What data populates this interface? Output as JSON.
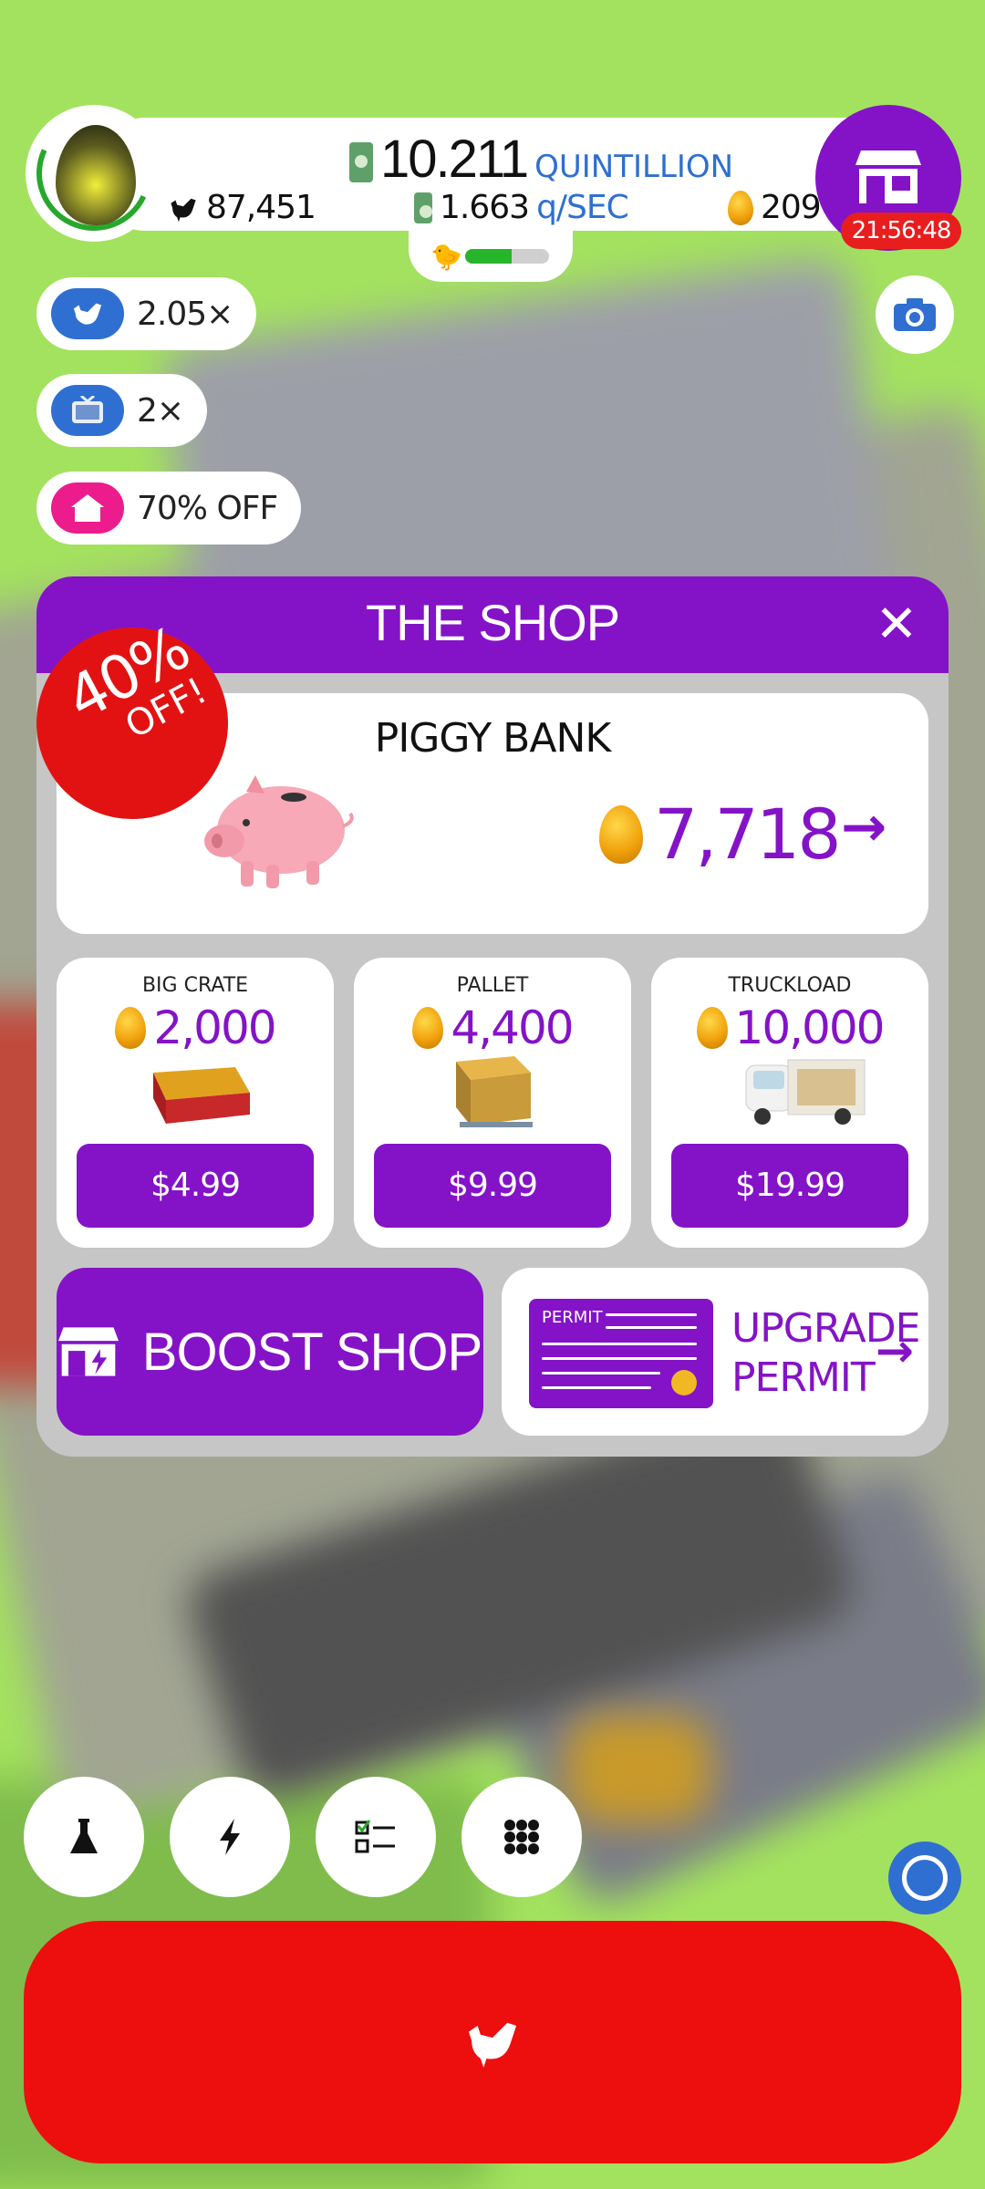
{
  "header": {
    "money_value": "10.211",
    "money_unit": "QUINTILLION",
    "chicken_count": "87,451",
    "rate_value": "1.663",
    "rate_unit": "q/SEC",
    "golden_eggs": "209",
    "progress": 0.55,
    "shop_timer": "21:56:48"
  },
  "boosts": [
    {
      "icon": "chicken-icon",
      "label": "2.05×",
      "color": "#2f6fd1"
    },
    {
      "icon": "tv-icon",
      "label": "2×",
      "color": "#2f6fd1"
    },
    {
      "icon": "house-icon",
      "label": "70% OFF",
      "color": "#ec1c8c"
    }
  ],
  "shop": {
    "title": "THE SHOP",
    "featured": {
      "name": "PIGGY BANK",
      "price": "7,718",
      "discount_pct": "40%",
      "discount_off": "OFF!"
    },
    "items": [
      {
        "name": "BIG CRATE",
        "eggs": "2,000",
        "price": "$4.99"
      },
      {
        "name": "PALLET",
        "eggs": "4,400",
        "price": "$9.99"
      },
      {
        "name": "TRUCKLOAD",
        "eggs": "10,000",
        "price": "$19.99"
      }
    ],
    "boost_label": "BOOST SHOP",
    "permit_card_label": "PERMIT",
    "permit_line1": "UPGRADE",
    "permit_line2": "PERMIT"
  },
  "nav": [
    "flask-icon",
    "lightning-icon",
    "checklist-icon",
    "grid-icon"
  ],
  "colors": {
    "purple": "#8413c7",
    "red": "#ed0e0e",
    "green_bg": "#a3e25e",
    "blue": "#2f6fd1"
  }
}
